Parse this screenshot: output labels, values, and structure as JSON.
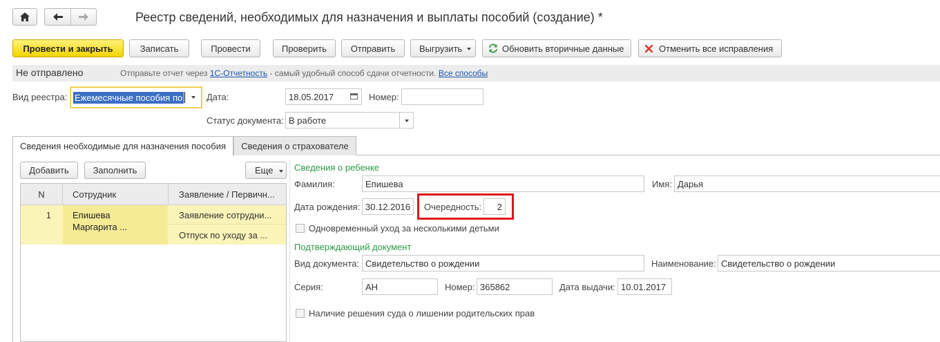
{
  "title": "Реестр сведений, необходимых для назначения и выплаты пособий (создание) *",
  "toolbar": {
    "post_close": "Провести и закрыть",
    "save": "Записать",
    "post": "Провести",
    "check": "Проверить",
    "send": "Отправить",
    "export": "Выгрузить",
    "refresh": "Обновить вторичные данные",
    "cancel_fixes": "Отменить все исправления"
  },
  "status_bar": {
    "status": "Не отправлено",
    "hint_prefix": "Отправьте отчет через",
    "service_link": "1С-Отчетность",
    "hint_suffix": "- самый удобный способ сдачи отчетности.",
    "all_methods_link": "Все способы"
  },
  "form": {
    "registry_type_label": "Вид реестра:",
    "registry_type_value": "Ежемесячные пособия по",
    "date_label": "Дата:",
    "date_value": "18.05.2017",
    "number_label": "Номер:",
    "number_value": "",
    "doc_status_label": "Статус документа:",
    "doc_status_value": "В работе"
  },
  "tabs": [
    "Сведения необходимые для назначения пособия",
    "Сведения о страхователе"
  ],
  "list": {
    "add": "Добавить",
    "fill": "Заполнить",
    "more": "Еще",
    "columns": [
      "N",
      "Сотрудник",
      "Заявление / Первичн..."
    ],
    "rows": [
      {
        "n": "1",
        "employee_line1": "Епишева",
        "employee_line2": "Маргарита ...",
        "doc1": "Заявление сотрудни...",
        "doc2": "Отпуск по уходу за ..."
      }
    ]
  },
  "child": {
    "section_title": "Сведения о ребенке",
    "surname_label": "Фамилия:",
    "surname_value": "Епишева",
    "name_label": "Имя:",
    "name_value": "Дарья",
    "birth_label": "Дата рождения:",
    "birth_value": "30.12.2016",
    "order_label": "Очередность:",
    "order_value": "2",
    "simultaneous_label": "Одновременный уход за несколькими детьми"
  },
  "document": {
    "section_title": "Подтверждающий документ",
    "type_label": "Вид документа:",
    "type_value": "Свидетельство о рождении",
    "name_label": "Наименование:",
    "name_value": "Свидетельство о рождении",
    "series_label": "Серия:",
    "series_value": "АН",
    "number_label": "Номер:",
    "number_value": "365862",
    "issue_label": "Дата выдачи:",
    "issue_value": "10.01.2017",
    "court_label": "Наличие решения суда о лишении родительских прав"
  },
  "colors": {
    "primary_button": "#f5d800",
    "highlight_frame": "#e0161b",
    "section_title": "#2e9a45",
    "selected_row": "#fbf4b8"
  }
}
